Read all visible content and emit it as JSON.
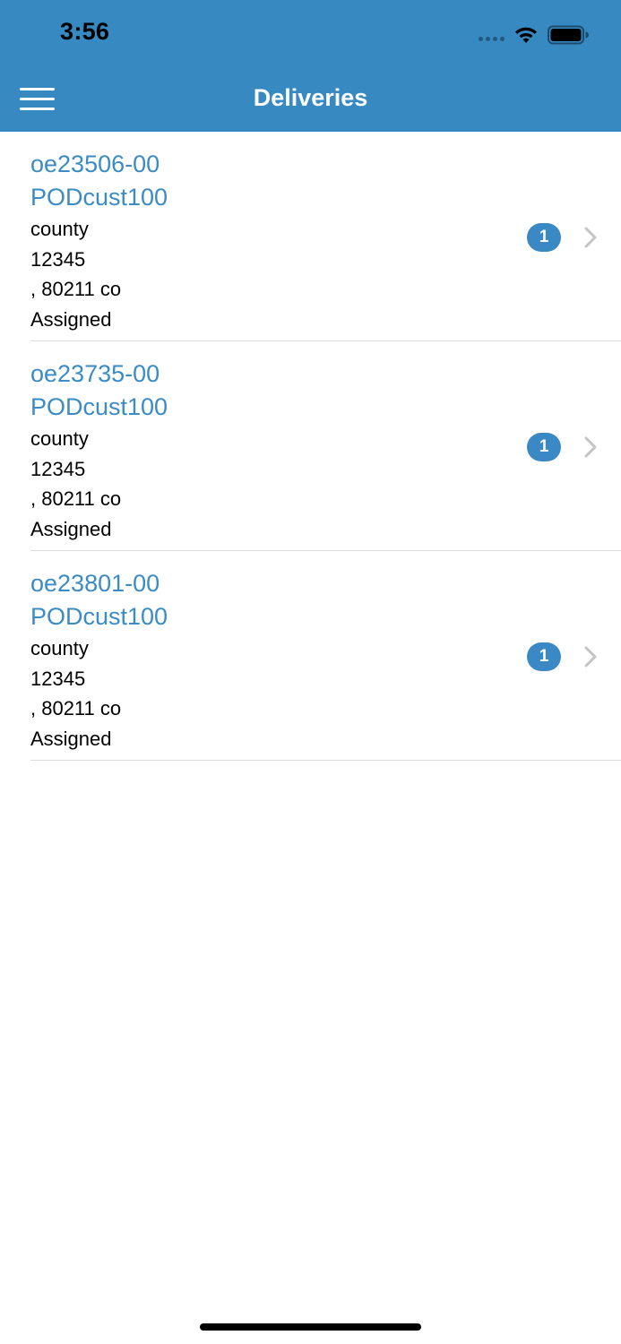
{
  "status_bar": {
    "time": "3:56",
    "icons": [
      "cellular-signal-icon",
      "wifi-icon",
      "battery-icon"
    ]
  },
  "nav": {
    "title": "Deliveries",
    "menu_icon": "hamburger-menu-icon"
  },
  "colors": {
    "header_bg": "#3789c2",
    "accent": "#3b8bc4",
    "badge": "#3b89c4",
    "divider": "#dcdcdc",
    "chevron": "#c4c4c7"
  },
  "deliveries": [
    {
      "order": "oe23506-00",
      "customer": "PODcust100",
      "county": "county",
      "zip": "12345",
      "city_line": ", 80211 co",
      "status": "Assigned",
      "count": "1"
    },
    {
      "order": "oe23735-00",
      "customer": "PODcust100",
      "county": "county",
      "zip": "12345",
      "city_line": ", 80211 co",
      "status": "Assigned",
      "count": "1"
    },
    {
      "order": "oe23801-00",
      "customer": "PODcust100",
      "county": "county",
      "zip": "12345",
      "city_line": ", 80211 co",
      "status": "Assigned",
      "count": "1"
    }
  ]
}
